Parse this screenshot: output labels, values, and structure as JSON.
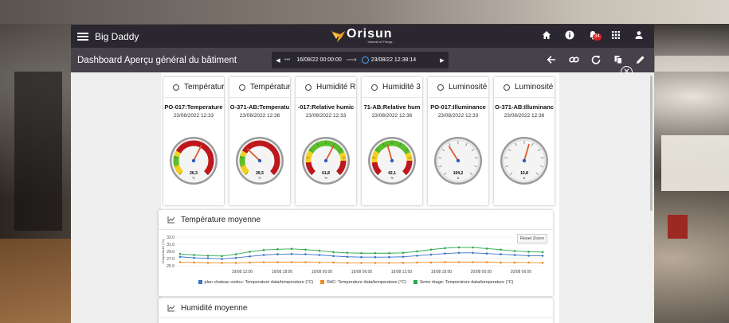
{
  "header": {
    "app_title": "Big Daddy",
    "logo_text": "Orisun",
    "logo_tagline": "Internet of Things",
    "notification_count": "34"
  },
  "subbar": {
    "title": "Dashboard Aperçu général du bâtiment",
    "date_from": "16/08/22 00:00:00",
    "date_to": "23/08/22 12:38:14"
  },
  "colors": {
    "topbar": "#2b2730",
    "subbar": "#46414b",
    "series_blue": "#3b73c7",
    "series_orange": "#f08a24",
    "series_green": "#2fa84f"
  },
  "cards": [
    {
      "title": "Températur",
      "sensor": "PO-017:Temperature",
      "time": "23/08/2022 12:33",
      "kind": "temp",
      "value_label": "26,3",
      "unit": "°C",
      "fraction": 0.6
    },
    {
      "title": "Températur",
      "sensor": "O-371-AB:Temperatu",
      "time": "23/08/2022 12:36",
      "kind": "temp",
      "value_label": "26,5",
      "unit": "°C",
      "fraction": 0.33
    },
    {
      "title": "Humidité R",
      "sensor": "-017:Relative humic",
      "time": "23/08/2022 12:33",
      "kind": "hum",
      "value_label": "61,8",
      "unit": "%",
      "fraction": 0.6
    },
    {
      "title": "Humidité 3",
      "sensor": "71-AB:Relative hum",
      "time": "23/08/2022 12:36",
      "kind": "hum",
      "value_label": "42,1",
      "unit": "%",
      "fraction": 0.44
    },
    {
      "title": "Luminosité",
      "sensor": "PO-017:Illuminance",
      "time": "23/08/2022 12:33",
      "kind": "lux",
      "value_label": "104,2",
      "unit": "lx",
      "fraction": 0.38
    },
    {
      "title": "Luminosité",
      "sensor": "O-371-AB:Illuminanc",
      "time": "23/08/2022 12:36",
      "kind": "lux",
      "value_label": "10,8",
      "unit": "lx",
      "fraction": 0.56
    }
  ],
  "temp_panel": {
    "title": "Température moyenne",
    "reset_zoom": "Reset Zoom",
    "chart_data": {
      "type": "line",
      "y_ticks": [
        "33.0",
        "31.0",
        "29.0",
        "27.0",
        "25.0"
      ],
      "ylim": [
        25,
        33
      ],
      "x_ticks": [
        "19/08 12:00",
        "19/08 18:00",
        "19/08 00:00",
        "19/08 06:00",
        "19/08 12:00",
        "19/08 18:00",
        "20/08 00:00",
        "20/08 06:00"
      ],
      "series": [
        {
          "name": "plan chateau vodou: Temperature data/temperature (°C)",
          "color": "#3b73c7",
          "values": [
            27.5,
            27.2,
            27.1,
            26.9,
            27.2,
            27.6,
            28.0,
            28.2,
            28.3,
            28.2,
            28.0,
            27.7,
            27.5,
            27.4,
            27.4,
            27.4,
            27.5,
            27.8,
            28.1,
            28.4,
            28.6,
            28.6,
            28.4,
            28.2,
            28.0,
            27.8,
            27.8
          ]
        },
        {
          "name": "RdC: Temperature data/temperature (°C)",
          "color": "#f08a24",
          "values": [
            26.0,
            25.9,
            25.8,
            25.8,
            25.8,
            25.9,
            26.0,
            26.0,
            26.0,
            26.0,
            25.9,
            25.9,
            25.8,
            25.8,
            25.8,
            25.8,
            25.8,
            25.9,
            25.9,
            26.0,
            26.0,
            26.0,
            26.0,
            25.9,
            25.9,
            25.9,
            25.8
          ]
        },
        {
          "name": "3eme étage: Temperature data/temperature (°C)",
          "color": "#2fa84f",
          "values": [
            28.3,
            28.0,
            27.8,
            27.7,
            28.2,
            28.9,
            29.4,
            29.6,
            29.7,
            29.5,
            29.2,
            28.8,
            28.6,
            28.5,
            28.5,
            28.5,
            28.6,
            29.0,
            29.5,
            29.9,
            30.1,
            30.1,
            29.8,
            29.5,
            29.1,
            28.9,
            28.8
          ]
        }
      ],
      "ylabel": "Temperature (°C)"
    }
  },
  "hum_panel": {
    "title": "Humidité moyenne"
  }
}
